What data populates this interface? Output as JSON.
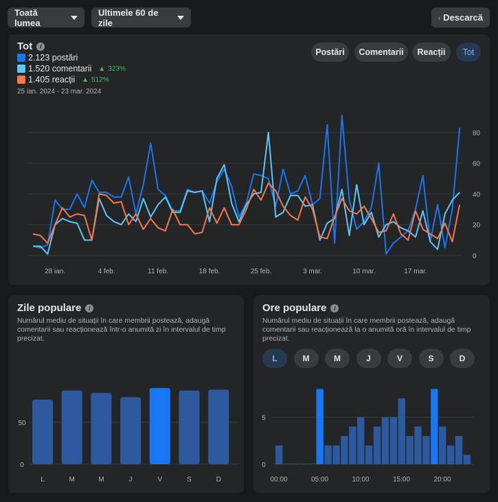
{
  "toolbar": {
    "audience": "Toată lumea",
    "period": "Ultimele 60 de zile",
    "download": "Descarcă"
  },
  "main": {
    "title": "Tot",
    "legend": [
      {
        "label": "2.123 postări",
        "color": "#1877f2"
      },
      {
        "label": "1.520 comentarii",
        "color": "#5ac8fa",
        "change": "323%"
      },
      {
        "label": "1.405 reacții",
        "color": "#f5784e",
        "change": "512%"
      }
    ],
    "range": "25 ian. 2024 - 23 mar. 2024",
    "filters": [
      "Postări",
      "Comentarii",
      "Reacții",
      "Tot"
    ],
    "active_filter": "Tot"
  },
  "popular_days": {
    "title": "Zile populare",
    "desc": "Numărul mediu de situații în care membrii postează, adaugă comentarii sau reacționează într-o anumită zi în intervalul de timp precizat."
  },
  "popular_hours": {
    "title": "Ore populare",
    "desc": "Numărul mediu de situații în care membrii postează, adaugă comentarii sau reacționează la o anumită oră în intervalul de timp precizat.",
    "days": [
      "L",
      "M",
      "M",
      "J",
      "V",
      "S",
      "D"
    ],
    "active_day": 0
  },
  "chart_data": [
    {
      "type": "line",
      "x_ticks": [
        "28 ian.",
        "4 feb.",
        "11 feb.",
        "18 feb.",
        "25 feb.",
        "3 mar.",
        "10 mar.",
        "17 mar."
      ],
      "y_ticks": [
        0,
        20,
        40,
        60,
        80
      ],
      "ylim": [
        0,
        90
      ],
      "x_range": [
        "25 ian. 2024",
        "23 mar. 2024"
      ],
      "grid": true,
      "series": [
        {
          "name": "postări",
          "color": "#1877f2",
          "values": [
            6,
            5,
            7,
            36,
            30,
            30,
            40,
            31,
            49,
            41,
            41,
            38,
            38,
            51,
            27,
            46,
            73,
            43,
            39,
            29,
            29,
            43,
            41,
            42,
            34,
            48,
            56,
            45,
            25,
            34,
            53,
            52,
            50,
            32,
            56,
            40,
            42,
            52,
            33,
            37,
            85,
            8,
            91,
            36,
            17,
            22,
            31,
            60,
            1,
            8,
            12,
            16,
            30,
            52,
            9,
            33,
            5,
            30,
            83
          ]
        },
        {
          "name": "comentarii",
          "color": "#5ac8fa",
          "values": [
            6,
            6,
            1,
            20,
            24,
            22,
            21,
            10,
            10,
            37,
            26,
            22,
            20,
            27,
            22,
            37,
            25,
            33,
            38,
            28,
            28,
            42,
            41,
            42,
            22,
            50,
            59,
            34,
            22,
            33,
            40,
            41,
            80,
            25,
            28,
            39,
            39,
            32,
            33,
            10,
            21,
            24,
            43,
            13,
            46,
            20,
            28,
            12,
            20,
            22,
            18,
            16,
            12,
            29,
            9,
            4,
            27,
            36,
            41
          ]
        },
        {
          "name": "reacții",
          "color": "#f5784e",
          "values": [
            14,
            13,
            8,
            20,
            31,
            25,
            27,
            26,
            10,
            40,
            39,
            34,
            35,
            20,
            27,
            17,
            24,
            18,
            16,
            30,
            20,
            20,
            14,
            15,
            31,
            21,
            31,
            20,
            20,
            30,
            43,
            36,
            47,
            42,
            32,
            26,
            23,
            38,
            30,
            12,
            11,
            25,
            37,
            29,
            27,
            32,
            24,
            15,
            16,
            27,
            14,
            10,
            29,
            17,
            14,
            11,
            21,
            9,
            33
          ]
        }
      ]
    },
    {
      "type": "bar",
      "categories": [
        "L",
        "M",
        "M",
        "J",
        "V",
        "S",
        "D"
      ],
      "values": [
        77,
        88,
        85,
        80,
        91,
        88,
        89
      ],
      "highlight": 4,
      "y_ticks": [
        0,
        50
      ],
      "ylim": [
        0,
        100
      ]
    },
    {
      "type": "bar",
      "categories": [
        "00:00",
        "01:00",
        "02:00",
        "03:00",
        "04:00",
        "05:00",
        "06:00",
        "07:00",
        "08:00",
        "09:00",
        "10:00",
        "11:00",
        "12:00",
        "13:00",
        "14:00",
        "15:00",
        "16:00",
        "17:00",
        "18:00",
        "19:00",
        "20:00",
        "21:00",
        "22:00",
        "23:00"
      ],
      "x_tick_labels": [
        "00:00",
        "05:00",
        "10:00",
        "15:00",
        "20:00"
      ],
      "values": [
        2,
        0,
        0,
        0,
        0,
        8,
        2,
        2,
        3,
        4,
        5,
        2,
        4,
        5,
        5,
        7,
        3,
        4,
        3,
        8,
        4,
        2,
        3,
        1
      ],
      "highlight": [
        5,
        19
      ],
      "y_ticks": [
        0,
        5
      ],
      "ylim": [
        0,
        9
      ]
    }
  ]
}
